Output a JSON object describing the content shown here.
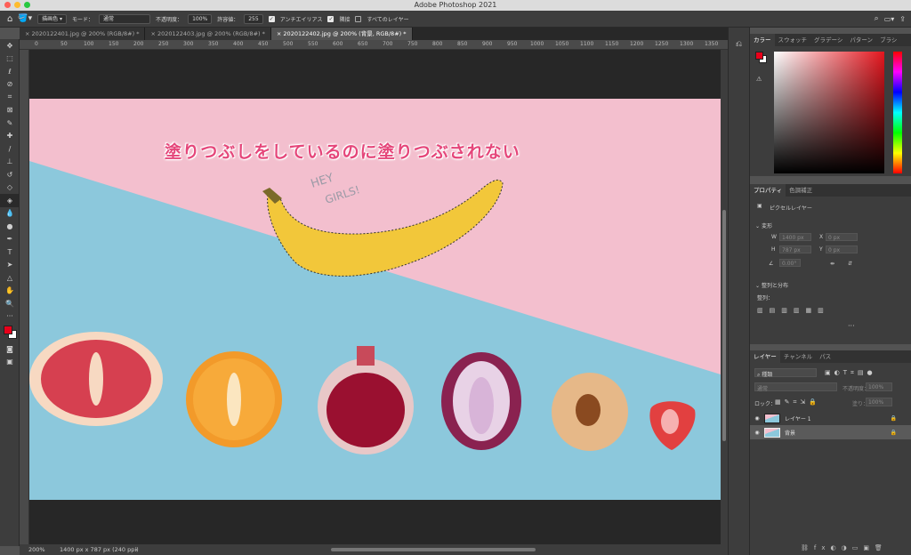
{
  "window": {
    "title": "Adobe Photoshop 2021"
  },
  "options": {
    "fill_source": "描画色",
    "mode_label": "モード：",
    "mode_value": "通常",
    "opacity_label": "不透明度：",
    "opacity_value": "100%",
    "tolerance_label": "許容値：",
    "tolerance_value": "255",
    "antialias_label": "アンチエイリアス",
    "contiguous_label": "隣接",
    "all_layers_label": "すべてのレイヤー"
  },
  "tabs": [
    {
      "label": "2020122401.jpg @ 200% (RGB/8#) *"
    },
    {
      "label": "2020122403.jpg @ 200% (RGB/8#) *"
    },
    {
      "label": "2020122402.jpg @ 200% (背景, RGB/8#) *"
    }
  ],
  "ruler": {
    "ticks": [
      "0",
      "50",
      "100",
      "150",
      "200",
      "250",
      "300",
      "350",
      "400",
      "450",
      "500",
      "550",
      "600",
      "650",
      "700",
      "750",
      "800",
      "850",
      "900",
      "950",
      "1000",
      "1050",
      "1100",
      "1150",
      "1200",
      "1250",
      "1300",
      "1350"
    ]
  },
  "canvas": {
    "overlay_text": "塗りつぶしをしているのに塗りつぶされない",
    "handwriting_1": "HEY",
    "handwriting_2": "GIRLS!"
  },
  "status": {
    "zoom": "200%",
    "doc_info": "1400 px x 787 px (240 ppi)"
  },
  "color_panel": {
    "tabs": [
      "カラー",
      "スウォッチ",
      "グラデーシ",
      "パターン",
      "ブラシ"
    ],
    "foreground": "#e8001a",
    "background": "#ffffff",
    "field_hue": "#e4161e"
  },
  "properties_panel": {
    "tabs": [
      "プロパティ",
      "色調補正"
    ],
    "layer_type": "ピクセルレイヤー",
    "transform_heading": "変形",
    "w_label": "W",
    "w_value": "1400 px",
    "x_label": "X",
    "x_value": "0 px",
    "h_label": "H",
    "h_value": "787 px",
    "y_label": "Y",
    "y_value": "0 px",
    "angle_value": "0.00°",
    "align_heading": "整列と分布",
    "align_label": "整列："
  },
  "layers_panel": {
    "tabs": [
      "レイヤー",
      "チャンネル",
      "パス"
    ],
    "filter_label": "種類",
    "blend_mode": "通常",
    "opacity_label": "不透明度：",
    "opacity_value": "100%",
    "lock_label": "ロック：",
    "fill_label": "塗り：",
    "fill_value": "100%",
    "layers": [
      {
        "name": "レイヤー 1",
        "selected": false
      },
      {
        "name": "背景",
        "selected": true
      }
    ]
  }
}
